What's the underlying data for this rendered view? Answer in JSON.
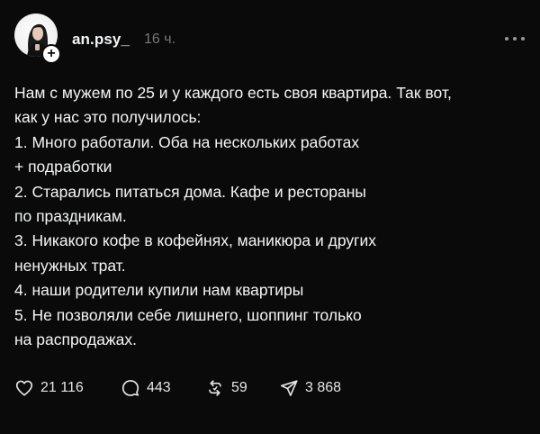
{
  "post": {
    "username": "an.psy_",
    "time": "16 ч.",
    "follow_symbol": "+",
    "lines": [
      "Нам с мужем по 25 и у каждого есть своя квартира. Так вот,",
      "как у нас это получилось:",
      "1. Много работали. Оба на нескольких работах",
      "+ подработки",
      "2. Старались питаться дома. Кафе и рестораны",
      "по праздникам.",
      "3. Никакого кофе в кофейнях, маникюра и других",
      "ненужных трат.",
      "4. наши родители купили нам квартиры",
      "5. Не позволяли себе лишнего, шоппинг только",
      "на распродажах."
    ]
  },
  "actions": {
    "likes": "21 116",
    "comments": "443",
    "reposts": "59",
    "shares": "3 868"
  },
  "icons": {
    "like": "heart-icon",
    "comment": "comment-bubble-icon",
    "repost": "repost-icon",
    "share": "send-icon",
    "more": "more-dots-icon"
  },
  "colors": {
    "background": "#0a0a0a",
    "text": "#f3f5f7",
    "muted": "#777777"
  }
}
